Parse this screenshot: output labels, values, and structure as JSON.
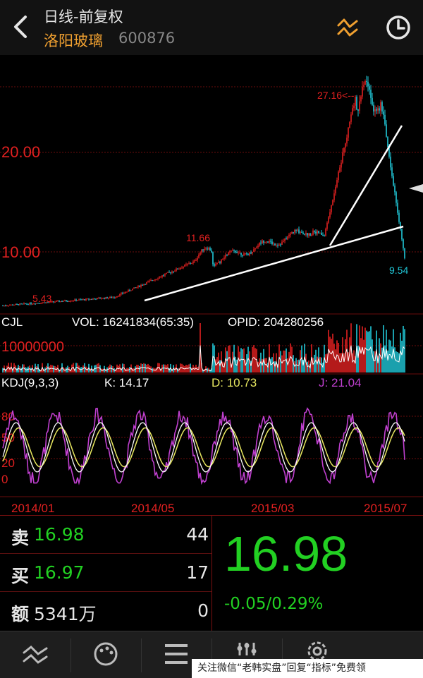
{
  "header": {
    "title": "日线-前复权",
    "stock_name": "洛阳玻璃",
    "stock_code": "600876"
  },
  "price_chart": {
    "y_ticks": [
      "20.00",
      "10.00"
    ],
    "high_label": "27.16",
    "low_label": "9.54",
    "mid_label_a": "11.66",
    "mid_label_b": "5.43"
  },
  "volume": {
    "indicator": "CJL",
    "vol_text": "VOL: 16241834(65:35)",
    "opid_text": "OPID: 204280256",
    "tick": "10000000"
  },
  "kdj": {
    "name": "KDJ(9,3,3)",
    "k": "K: 14.17",
    "d": "D: 10.73",
    "j": "J: 21.04",
    "ticks": [
      "80",
      "50",
      "20",
      "0"
    ]
  },
  "dates": [
    "2014/01",
    "2014/05",
    "2015/03",
    "2015/07"
  ],
  "quote": {
    "sell_label": "卖",
    "sell_price": "16.98",
    "sell_qty": "44",
    "buy_label": "买",
    "buy_price": "16.97",
    "buy_qty": "17",
    "amount_label": "额",
    "amount_value": "5341万",
    "amount_qty": "0",
    "last_price": "16.98",
    "change": "-0.05/0.29%"
  },
  "watermark": "关注微信“老韩实盘”回复“指标”免费领",
  "colors": {
    "up": "#e02020",
    "down": "#20c8d8",
    "green": "#22d022",
    "grid": "#6a0c0c",
    "yellow": "#e8e860",
    "magenta": "#c040d0",
    "orange": "#f0a030"
  },
  "icons": [
    "back-arrow-icon",
    "line-toggle-icon",
    "clock-icon",
    "kline-icon",
    "palette-icon",
    "menu-icon",
    "settings-sliders-icon",
    "gear-icon"
  ]
}
